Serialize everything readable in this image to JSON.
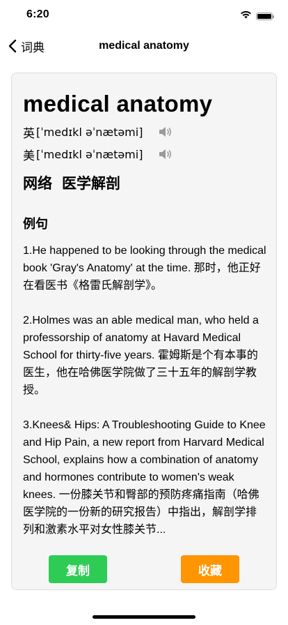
{
  "status_bar": {
    "time": "6:20"
  },
  "nav": {
    "back_label": "词典",
    "title": "medical anatomy"
  },
  "entry": {
    "word": "medical anatomy",
    "phonetics": [
      {
        "lang": "英",
        "ipa": "[ˈmedɪkl əˈnætəmi]"
      },
      {
        "lang": "美",
        "ipa": "[ˈmedɪkl əˈnætəmi]"
      }
    ],
    "net_def": {
      "source": "网络",
      "meaning": "医学解剖"
    },
    "examples_title": "例句",
    "examples": [
      "1.He happened to be looking through the medical book 'Gray's Anatomy' at the time. 那时，他正好在看医书《格雷氏解剖学》。",
      "2.Holmes was an able medical man, who held a professorship of anatomy at Havard Medical School for thirty-five years. 霍姆斯是个有本事的医生，他在哈佛医学院做了三十五年的解剖学教授。",
      "3.Knees& Hips: A Troubleshooting Guide to Knee and Hip Pain, a new report from Harvard Medical School, explains how a combination of anatomy and hormones contribute to women's weak knees. 一份膝关节和臀部的预防疼痛指南（哈佛医学院的一份新的研究报告）中指出，解剖学排列和激素水平对女性膝关节..."
    ]
  },
  "actions": {
    "copy_label": "复制",
    "favorite_label": "收藏"
  },
  "colors": {
    "copy_button": "#2ecc55",
    "favorite_button": "#ff9500",
    "card_background": "#f5f5f5"
  },
  "icons": {
    "back": "chevron-left-icon",
    "speaker": "speaker-icon",
    "wifi": "wifi-icon",
    "battery": "battery-icon"
  }
}
